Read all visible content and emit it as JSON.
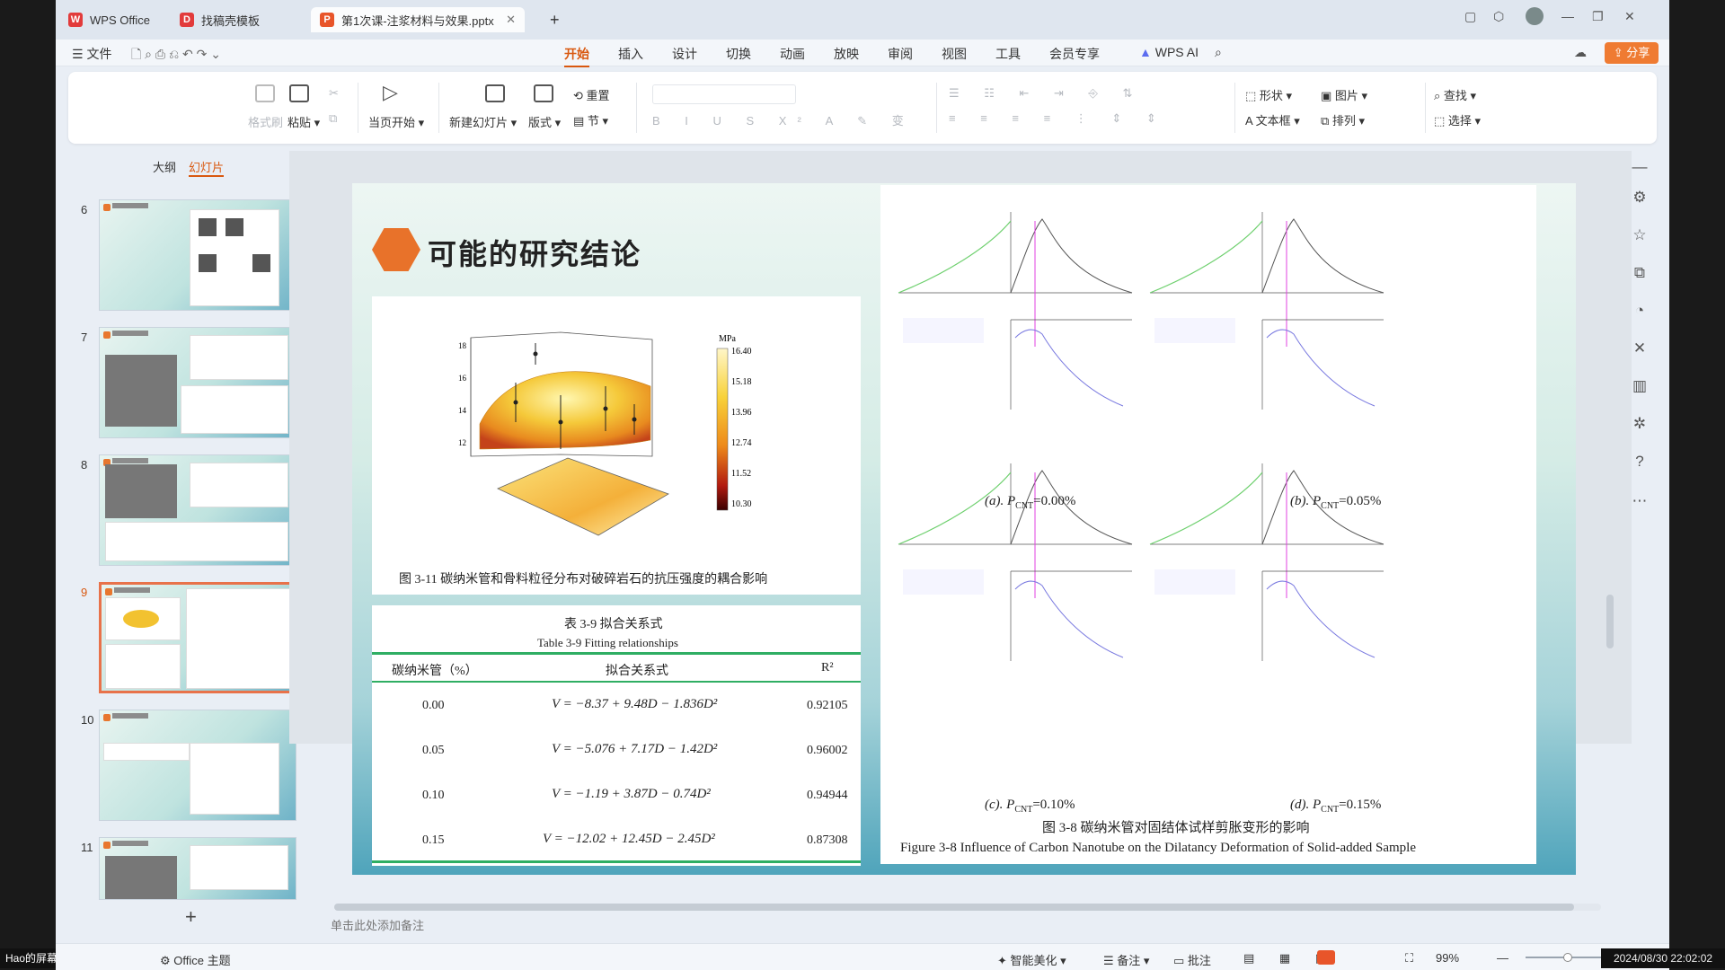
{
  "tabs": [
    {
      "label": "WPS Office"
    },
    {
      "label": "找稿壳模板"
    },
    {
      "label": "第1次课-注浆材料与效果.pptx"
    }
  ],
  "menu": {
    "file": "文件",
    "items": [
      "开始",
      "插入",
      "设计",
      "切换",
      "动画",
      "放映",
      "审阅",
      "视图",
      "工具",
      "会员专享"
    ],
    "wps_ai": "WPS AI",
    "share": "分享"
  },
  "ribbon": {
    "format_painter": "格式刷",
    "paste": "粘贴",
    "from_current": "当页开始",
    "new_slide": "新建幻灯片",
    "layout": "版式",
    "section": "节",
    "reset": "重置",
    "shape": "形状",
    "picture": "图片",
    "textbox": "文本框",
    "arrange": "排列",
    "find": "查找",
    "select": "选择"
  },
  "panel": {
    "outline": "大纲",
    "slides": "幻灯片",
    "thumb_numbers": [
      "6",
      "7",
      "8",
      "9",
      "10",
      "11"
    ],
    "selected": "9"
  },
  "slide": {
    "title": "可能的研究结论",
    "fig311_caption": "图 3-11  碳纳米管和骨料粒径分布对破碎岩石的抗压强度的耦合影响",
    "colorbar_unit": "MPa",
    "colorbar_ticks": [
      "16.40",
      "15.18",
      "13.96",
      "12.74",
      "11.52",
      "10.30"
    ],
    "table": {
      "title_cn": "表 3-9  拟合关系式",
      "title_en": "Table 3-9 Fitting relationships",
      "headers": [
        "碳纳米管（%）",
        "拟合关系式",
        "R²"
      ],
      "rows": [
        {
          "cnt": "0.00",
          "formula": "V = −8.37 + 9.48D − 1.836D²",
          "r2": "0.92105"
        },
        {
          "cnt": "0.05",
          "formula": "V = −5.076 + 7.17D − 1.42D²",
          "r2": "0.96002"
        },
        {
          "cnt": "0.10",
          "formula": "V = −1.19 + 3.87D − 0.74D²",
          "r2": "0.94944"
        },
        {
          "cnt": "0.15",
          "formula": "V = −12.02 + 12.45D − 2.45D²",
          "r2": "0.87308"
        }
      ]
    },
    "subplots": [
      {
        "label": "(a). P",
        "sub": "CNT",
        "value": "=0.00%"
      },
      {
        "label": "(b). P",
        "sub": "CNT",
        "value": "=0.05%"
      },
      {
        "label": "(c). P",
        "sub": "CNT",
        "value": "=0.10%"
      },
      {
        "label": "(d). P",
        "sub": "CNT",
        "value": "=0.15%"
      }
    ],
    "fig38_caption_cn": "图 3-8  碳纳米管对固结体试样剪胀变形的影响",
    "fig38_caption_en": "Figure 3-8 Influence of Carbon Nanotube on the Dilatancy Deformation of Solid-added Sample"
  },
  "notes_placeholder": "单击此处添加备注",
  "status": {
    "theme": "Office 主题",
    "beautify": "智能美化",
    "notes": "备注",
    "comments": "批注",
    "zoom": "99%"
  },
  "screen_share": "Hao的屏幕共享",
  "clock": "2024/08/30 22:02:02",
  "colors": {
    "accent": "#d9580f",
    "selection": "#e8724a",
    "green_rule": "#2fae63"
  }
}
